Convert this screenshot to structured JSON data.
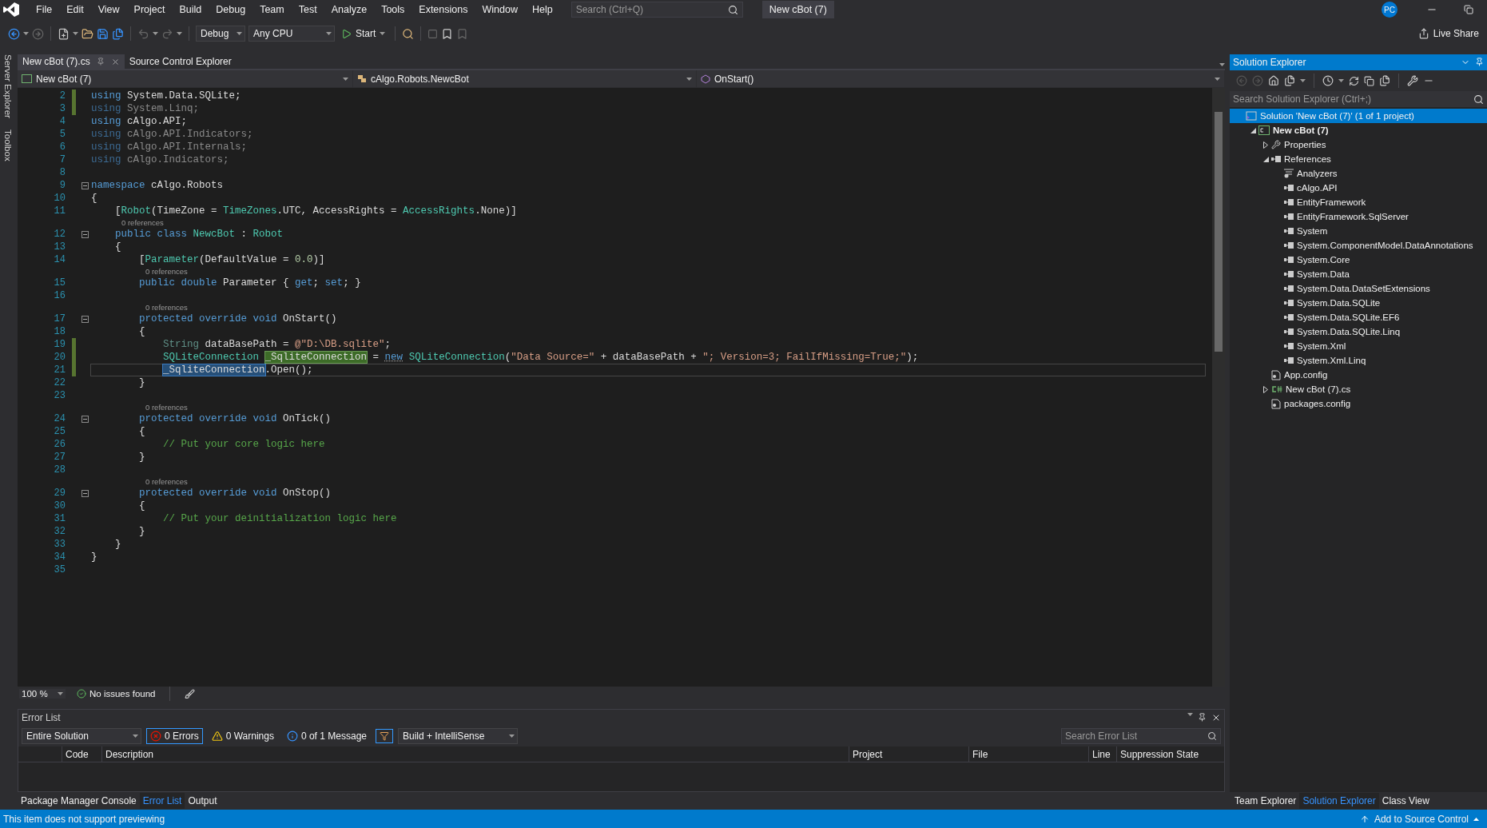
{
  "menu": [
    "File",
    "Edit",
    "View",
    "Project",
    "Build",
    "Debug",
    "Team",
    "Test",
    "Analyze",
    "Tools",
    "Extensions",
    "Window",
    "Help"
  ],
  "search": {
    "placeholder": "Search (Ctrl+Q)"
  },
  "window": {
    "title": "New cBot (7)",
    "avatar": "PC"
  },
  "toolbar": {
    "configuration": "Debug",
    "platform": "Any CPU",
    "start": "Start",
    "live_share": "Live Share"
  },
  "side_tabs": [
    "Server Explorer",
    "Toolbox"
  ],
  "doc_tabs": [
    {
      "label": "New cBot (7).cs",
      "selected": true
    },
    {
      "label": "Source Control Explorer",
      "selected": false
    }
  ],
  "nav_bar": {
    "project": "New cBot (7)",
    "type": "cAlgo.Robots.NewcBot",
    "member": "OnStart()"
  },
  "code": [
    {
      "kind": "line",
      "n": "2",
      "changed": true,
      "fold": false,
      "current": false,
      "tokens": [
        {
          "text": "using",
          "kind": "kw"
        },
        {
          "text": " System.Data.SQLite;",
          "kind": "plain"
        }
      ]
    },
    {
      "kind": "line",
      "n": "3",
      "changed": true,
      "fold": false,
      "current": false,
      "tokens": [
        {
          "text": "using",
          "kind": "dimkw"
        },
        {
          "text": " System.Linq;",
          "kind": "dim"
        }
      ]
    },
    {
      "kind": "line",
      "n": "4",
      "changed": false,
      "fold": false,
      "current": false,
      "tokens": [
        {
          "text": "using",
          "kind": "kw"
        },
        {
          "text": " cAlgo.API;",
          "kind": "plain"
        }
      ]
    },
    {
      "kind": "line",
      "n": "5",
      "changed": false,
      "fold": false,
      "current": false,
      "tokens": [
        {
          "text": "using",
          "kind": "dimkw"
        },
        {
          "text": " cAlgo.API.Indicators;",
          "kind": "dim"
        }
      ]
    },
    {
      "kind": "line",
      "n": "6",
      "changed": false,
      "fold": false,
      "current": false,
      "tokens": [
        {
          "text": "using",
          "kind": "dimkw"
        },
        {
          "text": " cAlgo.API.Internals;",
          "kind": "dim"
        }
      ]
    },
    {
      "kind": "line",
      "n": "7",
      "changed": false,
      "fold": false,
      "current": false,
      "tokens": [
        {
          "text": "using",
          "kind": "dimkw"
        },
        {
          "text": " cAlgo.Indicators;",
          "kind": "dim"
        }
      ]
    },
    {
      "kind": "line",
      "n": "8",
      "changed": false,
      "fold": false,
      "current": false
    },
    {
      "kind": "line",
      "n": "9",
      "changed": false,
      "fold": true,
      "current": false,
      "tokens": [
        {
          "text": "namespace",
          "kind": "kw"
        },
        {
          "text": " cAlgo.Robots",
          "kind": "plain"
        }
      ]
    },
    {
      "kind": "line",
      "n": "10",
      "changed": false,
      "fold": false,
      "current": false,
      "tokens": [
        {
          "text": "{",
          "kind": "plain"
        }
      ]
    },
    {
      "kind": "line",
      "n": "11",
      "changed": false,
      "fold": false,
      "current": false,
      "tokens": [
        {
          "text": "    [",
          "kind": "plain"
        },
        {
          "text": "Robot",
          "kind": "type"
        },
        {
          "text": "(TimeZone = ",
          "kind": "plain"
        },
        {
          "text": "TimeZones",
          "kind": "type"
        },
        {
          "text": ".UTC, AccessRights = ",
          "kind": "plain"
        },
        {
          "text": "AccessRights",
          "kind": "type"
        },
        {
          "text": ".None)]",
          "kind": "plain"
        }
      ]
    },
    {
      "kind": "lens",
      "text": "0 references"
    },
    {
      "kind": "line",
      "n": "12",
      "changed": false,
      "fold": true,
      "current": false,
      "tokens": [
        {
          "text": "    public class",
          "kind": "kw"
        },
        {
          "text": " NewcBot",
          "kind": "type"
        },
        {
          "text": " :",
          "kind": "plain"
        },
        {
          "text": " Robot",
          "kind": "type"
        }
      ]
    },
    {
      "kind": "line",
      "n": "13",
      "changed": false,
      "fold": false,
      "current": false,
      "tokens": [
        {
          "text": "    {",
          "kind": "plain"
        }
      ]
    },
    {
      "kind": "line",
      "n": "14",
      "changed": false,
      "fold": false,
      "current": false,
      "tokens": [
        {
          "text": "        [",
          "kind": "plain"
        },
        {
          "text": "Parameter",
          "kind": "type"
        },
        {
          "text": "(DefaultValue = ",
          "kind": "plain"
        },
        {
          "text": "0.0",
          "kind": "num"
        },
        {
          "text": ")]",
          "kind": "plain"
        }
      ]
    },
    {
      "kind": "lens",
      "text": "0 references"
    },
    {
      "kind": "line",
      "n": "15",
      "changed": false,
      "fold": false,
      "current": false,
      "tokens": [
        {
          "text": "        public double",
          "kind": "kw"
        },
        {
          "text": " Parameter { ",
          "kind": "plain"
        },
        {
          "text": "get",
          "kind": "kw"
        },
        {
          "text": "; ",
          "kind": "plain"
        },
        {
          "text": "set",
          "kind": "kw"
        },
        {
          "text": "; }",
          "kind": "plain"
        }
      ]
    },
    {
      "kind": "line",
      "n": "16",
      "changed": false,
      "fold": false,
      "current": false
    },
    {
      "kind": "lens",
      "text": "0 references"
    },
    {
      "kind": "line",
      "n": "17",
      "changed": false,
      "fold": true,
      "current": false,
      "tokens": [
        {
          "text": "        protected override void",
          "kind": "kw"
        },
        {
          "text": " OnStart()",
          "kind": "plain"
        }
      ]
    },
    {
      "kind": "line",
      "n": "18",
      "changed": false,
      "fold": false,
      "current": false,
      "tokens": [
        {
          "text": "        {",
          "kind": "plain"
        }
      ]
    },
    {
      "kind": "line",
      "n": "19",
      "changed": true,
      "fold": false,
      "current": false,
      "tokens": [
        {
          "text": "            String",
          "kind": "dimtype"
        },
        {
          "text": " dataBasePath = ",
          "kind": "plain"
        },
        {
          "text": "@\"D:\\DB.sqlite\"",
          "kind": "string"
        },
        {
          "text": ";",
          "kind": "plain"
        }
      ]
    },
    {
      "kind": "line",
      "n": "20",
      "changed": true,
      "fold": false,
      "current": false,
      "tokens": [
        {
          "text": "            SQLiteConnection ",
          "kind": "type"
        },
        {
          "text": "_SqliteConnection",
          "kind": "hldef"
        },
        {
          "text": " = ",
          "kind": "plain"
        },
        {
          "text": "new",
          "kind": "kwdots"
        },
        {
          "text": " SQLiteConnection",
          "kind": "type"
        },
        {
          "text": "(",
          "kind": "plain"
        },
        {
          "text": "\"Data Source=\"",
          "kind": "string"
        },
        {
          "text": " + dataBasePath + ",
          "kind": "plain"
        },
        {
          "text": "\"; Version=3; FailIfMissing=True;\"",
          "kind": "string"
        },
        {
          "text": ");",
          "kind": "plain"
        }
      ]
    },
    {
      "kind": "line",
      "n": "21",
      "changed": true,
      "fold": false,
      "current": true,
      "tokens": [
        {
          "text": "            _SqliteConnection",
          "kind": "hlref"
        },
        {
          "text": ".Open();",
          "kind": "plain"
        }
      ]
    },
    {
      "kind": "line",
      "n": "22",
      "changed": false,
      "fold": false,
      "current": false,
      "tokens": [
        {
          "text": "        }",
          "kind": "plain"
        }
      ]
    },
    {
      "kind": "line",
      "n": "23",
      "changed": false,
      "fold": false,
      "current": false
    },
    {
      "kind": "lens",
      "text": "0 references"
    },
    {
      "kind": "line",
      "n": "24",
      "changed": false,
      "fold": true,
      "current": false,
      "tokens": [
        {
          "text": "        protected override void",
          "kind": "kw"
        },
        {
          "text": " OnTick()",
          "kind": "plain"
        }
      ]
    },
    {
      "kind": "line",
      "n": "25",
      "changed": false,
      "fold": false,
      "current": false,
      "tokens": [
        {
          "text": "        {",
          "kind": "plain"
        }
      ]
    },
    {
      "kind": "line",
      "n": "26",
      "changed": false,
      "fold": false,
      "current": false,
      "tokens": [
        {
          "text": "            // Put your core logic here",
          "kind": "comment"
        }
      ]
    },
    {
      "kind": "line",
      "n": "27",
      "changed": false,
      "fold": false,
      "current": false,
      "tokens": [
        {
          "text": "        }",
          "kind": "plain"
        }
      ]
    },
    {
      "kind": "line",
      "n": "28",
      "changed": false,
      "fold": false,
      "current": false
    },
    {
      "kind": "lens",
      "text": "0 references"
    },
    {
      "kind": "line",
      "n": "29",
      "changed": false,
      "fold": true,
      "current": false,
      "tokens": [
        {
          "text": "        protected override void",
          "kind": "kw"
        },
        {
          "text": " OnStop()",
          "kind": "plain"
        }
      ]
    },
    {
      "kind": "line",
      "n": "30",
      "changed": false,
      "fold": false,
      "current": false,
      "tokens": [
        {
          "text": "        {",
          "kind": "plain"
        }
      ]
    },
    {
      "kind": "line",
      "n": "31",
      "changed": false,
      "fold": false,
      "current": false,
      "tokens": [
        {
          "text": "            // Put your deinitialization logic here",
          "kind": "comment"
        }
      ]
    },
    {
      "kind": "line",
      "n": "32",
      "changed": false,
      "fold": false,
      "current": false,
      "tokens": [
        {
          "text": "        }",
          "kind": "plain"
        }
      ]
    },
    {
      "kind": "line",
      "n": "33",
      "changed": false,
      "fold": false,
      "current": false,
      "tokens": [
        {
          "text": "    }",
          "kind": "plain"
        }
      ]
    },
    {
      "kind": "line",
      "n": "34",
      "changed": false,
      "fold": false,
      "current": false,
      "tokens": [
        {
          "text": "}",
          "kind": "plain"
        }
      ]
    },
    {
      "kind": "line",
      "n": "35",
      "changed": false,
      "fold": false,
      "current": false
    }
  ],
  "editor_status": {
    "zoom": "100 %",
    "issues": "No issues found"
  },
  "error_list": {
    "title": "Error List",
    "scope": "Entire Solution",
    "filters": [
      {
        "label": "0 Errors",
        "kind": "error",
        "selected": true
      },
      {
        "label": "0 Warnings",
        "kind": "warning",
        "selected": false
      },
      {
        "label": "0 of 1 Message",
        "kind": "info",
        "selected": false
      }
    ],
    "source": "Build + IntelliSense",
    "search_placeholder": "Search Error List",
    "columns": [
      "Code",
      "Description",
      "Project",
      "File",
      "Line",
      "Suppression State"
    ]
  },
  "bottom_tabs": [
    {
      "label": "Package Manager Console",
      "selected": false
    },
    {
      "label": "Error List",
      "selected": true
    },
    {
      "label": "Output",
      "selected": false
    }
  ],
  "solution_explorer": {
    "title": "Solution Explorer",
    "search_placeholder": "Search Solution Explorer (Ctrl+;)",
    "tree": [
      {
        "label": "Solution 'New cBot (7)' (1 of 1 project)",
        "kind": "solution",
        "selected": true,
        "children": [
          {
            "label": "New cBot (7)",
            "kind": "project",
            "selected": false,
            "expanded": true,
            "children": [
              {
                "label": "Properties",
                "kind": "properties",
                "selected": false,
                "expanded": false
              },
              {
                "label": "References",
                "kind": "references",
                "selected": false,
                "expanded": true,
                "children": [
                  {
                    "label": "Analyzers",
                    "kind": "analyzers",
                    "selected": false
                  },
                  {
                    "label": "cAlgo.API",
                    "kind": "reference",
                    "selected": false
                  },
                  {
                    "label": "EntityFramework",
                    "kind": "reference",
                    "selected": false
                  },
                  {
                    "label": "EntityFramework.SqlServer",
                    "kind": "reference",
                    "selected": false
                  },
                  {
                    "label": "System",
                    "kind": "reference",
                    "selected": false
                  },
                  {
                    "label": "System.ComponentModel.DataAnnotations",
                    "kind": "reference",
                    "selected": false
                  },
                  {
                    "label": "System.Core",
                    "kind": "reference",
                    "selected": false
                  },
                  {
                    "label": "System.Data",
                    "kind": "reference",
                    "selected": false
                  },
                  {
                    "label": "System.Data.DataSetExtensions",
                    "kind": "reference",
                    "selected": false
                  },
                  {
                    "label": "System.Data.SQLite",
                    "kind": "reference",
                    "selected": false
                  },
                  {
                    "label": "System.Data.SQLite.EF6",
                    "kind": "reference",
                    "selected": false
                  },
                  {
                    "label": "System.Data.SQLite.Linq",
                    "kind": "reference",
                    "selected": false
                  },
                  {
                    "label": "System.Xml",
                    "kind": "reference",
                    "selected": false
                  },
                  {
                    "label": "System.Xml.Linq",
                    "kind": "reference",
                    "selected": false
                  }
                ]
              },
              {
                "label": "App.config",
                "kind": "config",
                "selected": false
              },
              {
                "label": "New cBot (7).cs",
                "kind": "csfile",
                "selected": false,
                "expanded": false
              },
              {
                "label": "packages.config",
                "kind": "config",
                "selected": false
              }
            ]
          }
        ]
      }
    ]
  },
  "right_tabs": [
    {
      "label": "Team Explorer",
      "selected": false
    },
    {
      "label": "Solution Explorer",
      "selected": true
    },
    {
      "label": "Class View",
      "selected": false
    }
  ],
  "status_bar": {
    "message": "This item does not support previewing",
    "source_control": "Add to Source Control"
  }
}
